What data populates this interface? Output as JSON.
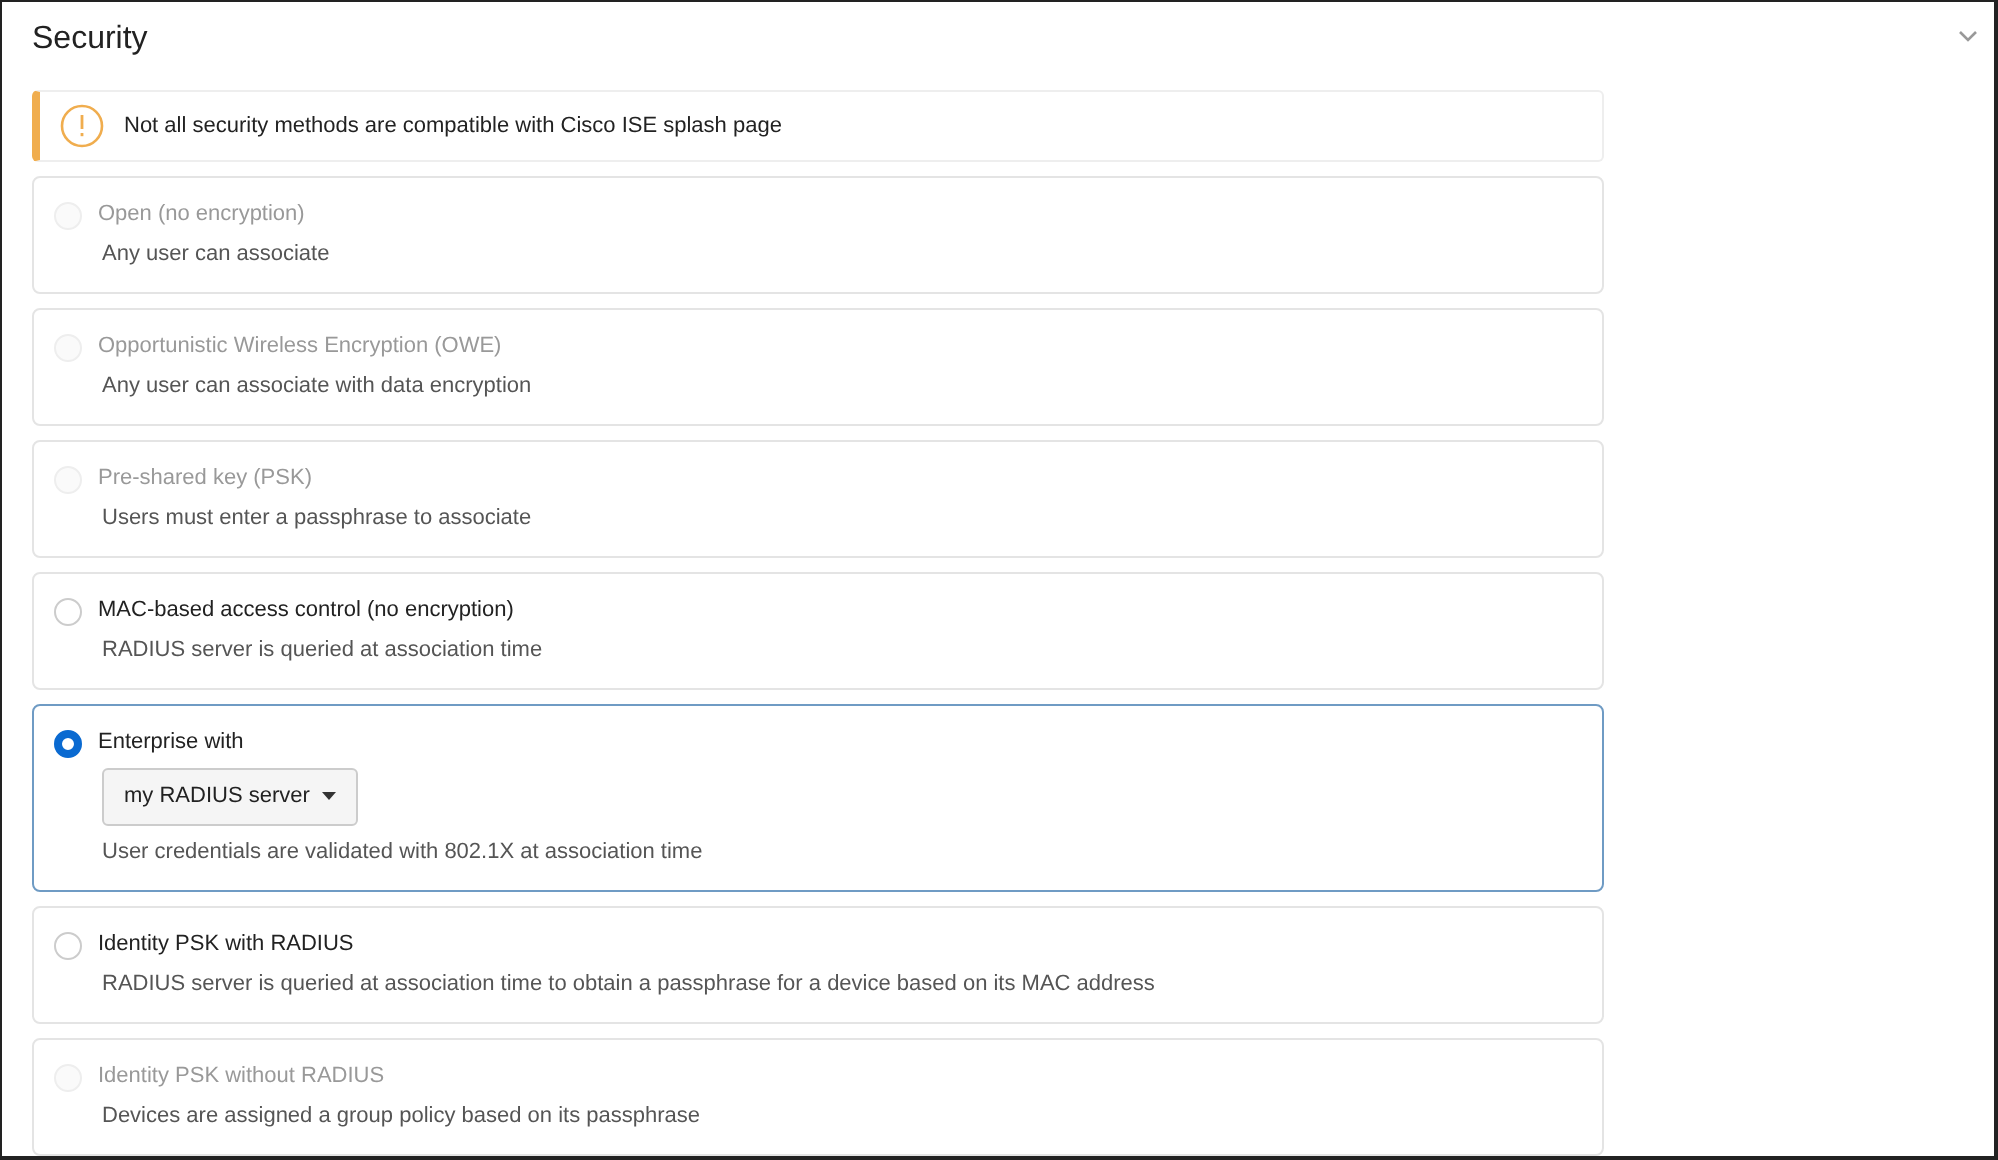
{
  "section": {
    "title": "Security",
    "expanded": true
  },
  "alert": {
    "text": "Not all security methods are compatible with Cisco ISE splash page"
  },
  "options": [
    {
      "kind": "plain",
      "label": "Open (no encryption)",
      "description": "Any user can associate",
      "selected": false,
      "disabled": true
    },
    {
      "kind": "plain",
      "label": "Opportunistic Wireless Encryption (OWE)",
      "description": "Any user can associate with data encryption",
      "selected": false,
      "disabled": true
    },
    {
      "kind": "plain",
      "label": "Pre-shared key (PSK)",
      "description": "Users must enter a passphrase to associate",
      "selected": false,
      "disabled": true
    },
    {
      "kind": "plain",
      "label": "MAC-based access control (no encryption)",
      "description": "RADIUS server is queried at association time",
      "selected": false,
      "disabled": false
    },
    {
      "kind": "select",
      "label": "Enterprise with",
      "select_value": "my RADIUS server",
      "description": "User credentials are validated with 802.1X at association time",
      "selected": true,
      "disabled": false
    },
    {
      "kind": "plain",
      "label": "Identity PSK with RADIUS",
      "description": "RADIUS server is queried at association time to obtain a passphrase for a device based on its MAC address",
      "selected": false,
      "disabled": false
    },
    {
      "kind": "plain",
      "label": "Identity PSK without RADIUS",
      "description": "Devices are assigned a group policy based on its passphrase",
      "selected": false,
      "disabled": true
    }
  ]
}
